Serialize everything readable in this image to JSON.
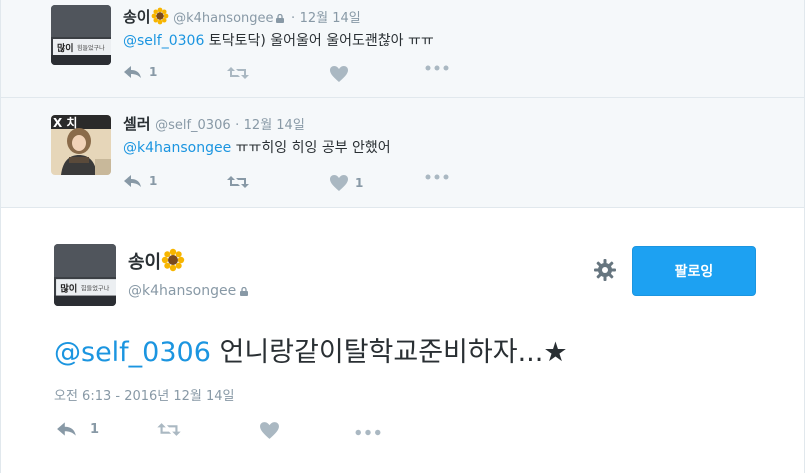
{
  "replies": [
    {
      "name": "송이",
      "name_emoji": "sunflower",
      "handle": "@k4hansongee",
      "protected": true,
      "dot": "·",
      "date": "12월 14일",
      "mention": "@self_0306",
      "text": " 토닥토닥) 울어울어 울어도괜찮아 ㅠㅠ",
      "reply_count": "1",
      "retweet_count": "",
      "like_count": ""
    },
    {
      "name": "셀러",
      "handle": "@self_0306",
      "protected": false,
      "dot": "·",
      "date": "12월 14일",
      "mention": "@k4hansongee",
      "text": " ㅠㅠ히잉 히잉 공부 안했어",
      "reply_count": "1",
      "retweet_count": "",
      "like_count": "1"
    }
  ],
  "main_tweet": {
    "name": "송이",
    "name_emoji": "sunflower",
    "handle": "@k4hansongee",
    "protected": true,
    "follow_label": "팔로잉",
    "mention": "@self_0306",
    "text": " 언니랑같이탈학교준비하자...★",
    "timestamp": "오전 6:13 - 2016년 12월 14일",
    "reply_count": "1",
    "retweet_count": "",
    "like_count": ""
  },
  "colors": {
    "accent": "#1da1f2",
    "mention": "#1b95e0",
    "muted": "#8899a6",
    "icon": "#aab8c2"
  },
  "icons": [
    "reply-icon",
    "retweet-icon",
    "like-icon",
    "more-icon",
    "lock-icon",
    "gear-icon",
    "sunflower-emoji"
  ]
}
